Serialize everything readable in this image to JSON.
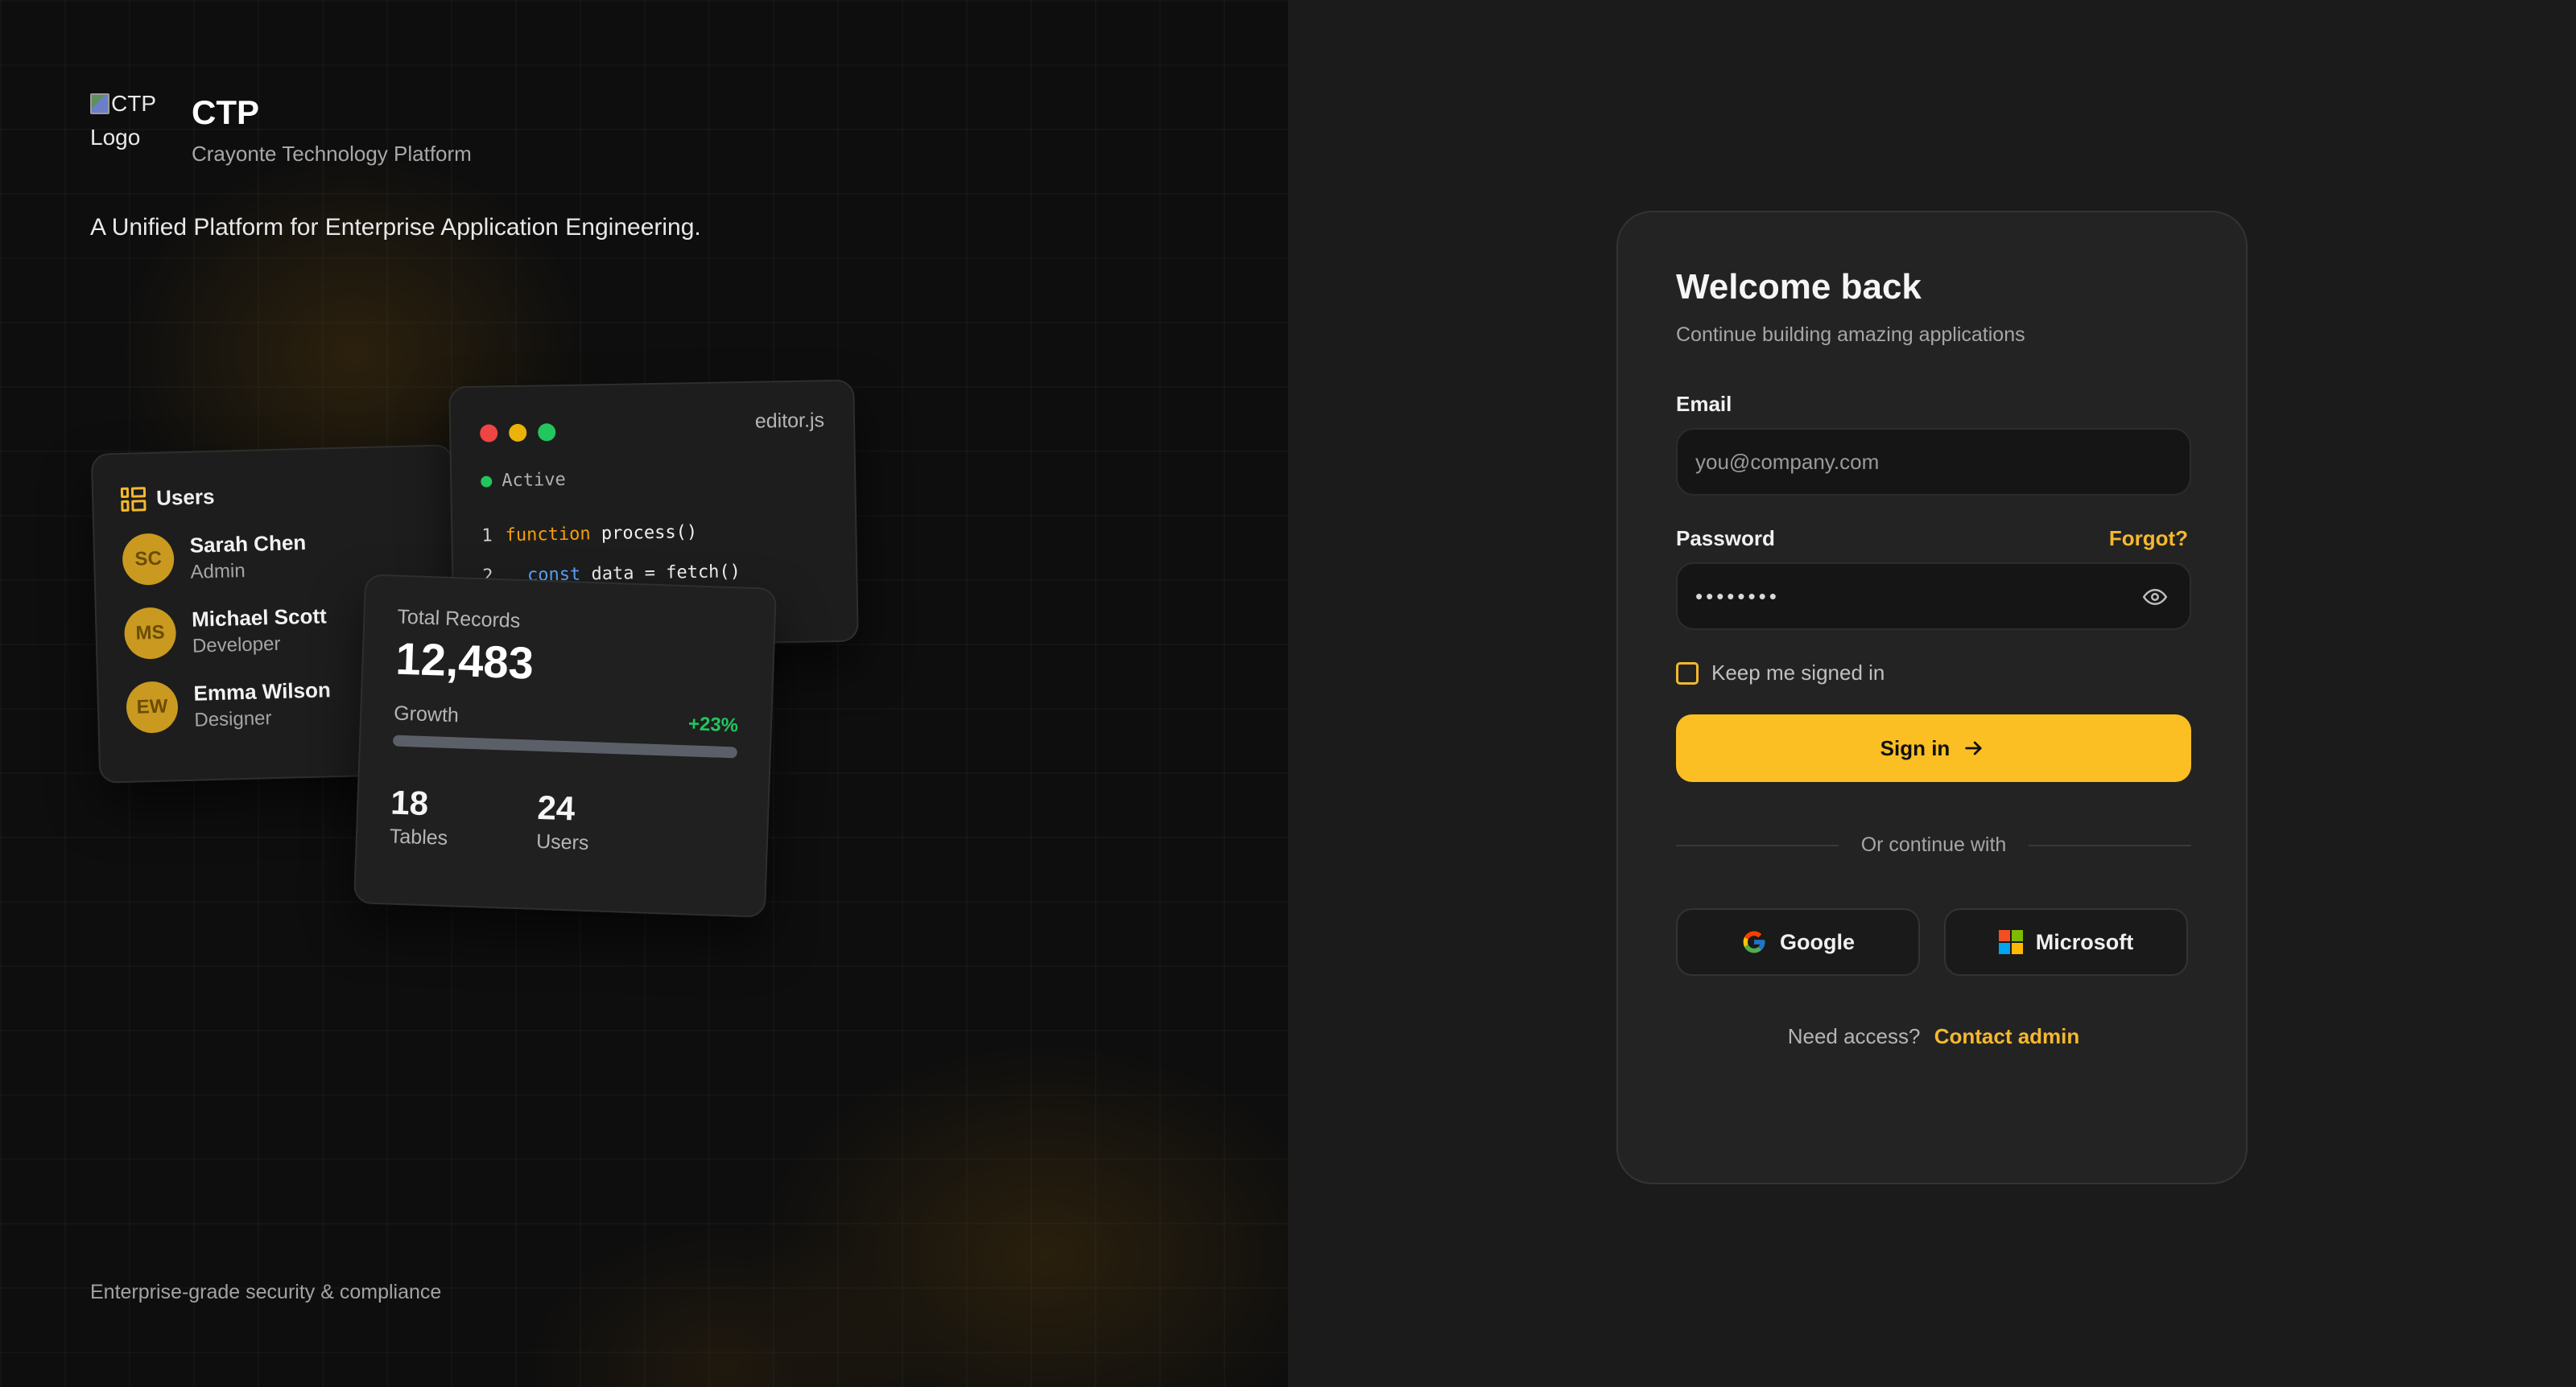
{
  "brand": {
    "logo_alt": "CTP Logo",
    "logo_alt_line1": "CTP",
    "logo_alt_line2": "Logo",
    "name": "CTP",
    "subtitle": "Crayonte Technology Platform"
  },
  "hero": {
    "tagline": "A Unified Platform for Enterprise Application Engineering.",
    "footer": "Enterprise-grade security & compliance"
  },
  "users_card": {
    "title": "Users",
    "users": [
      {
        "initials": "SC",
        "name": "Sarah Chen",
        "role": "Admin"
      },
      {
        "initials": "MS",
        "name": "Michael Scott",
        "role": "Developer"
      },
      {
        "initials": "EW",
        "name": "Emma Wilson",
        "role": "Designer"
      }
    ]
  },
  "editor_card": {
    "filename": "editor.js",
    "status": "Active",
    "lines": [
      {
        "num": "1",
        "keyword": "function",
        "rest": " process()"
      },
      {
        "num": "2",
        "keyword": "const",
        "rest": " data = fetch()"
      }
    ],
    "dot_colors": [
      "#ef4444",
      "#eab308",
      "#22c55e"
    ]
  },
  "stats_card": {
    "total_label": "Total Records",
    "total_value": "12,483",
    "growth_label": "Growth",
    "growth_value": "+23%",
    "growth_fill_fraction": 1.0,
    "tables_value": "18",
    "tables_label": "Tables",
    "users_value": "24",
    "users_label": "Users"
  },
  "login": {
    "title": "Welcome back",
    "subtitle": "Continue building amazing applications",
    "email_label": "Email",
    "email_placeholder": "you@company.com",
    "password_label": "Password",
    "forgot_label": "Forgot?",
    "password_mask": "••••••••",
    "keep_signed_in": "Keep me signed in",
    "signin_label": "Sign in",
    "divider_text": "Or continue with",
    "google_label": "Google",
    "microsoft_label": "Microsoft",
    "access_question": "Need access?",
    "access_link": "Contact admin"
  },
  "colors": {
    "accent": "#fbbf24",
    "link": "#f5b82e",
    "success": "#22c55e"
  }
}
